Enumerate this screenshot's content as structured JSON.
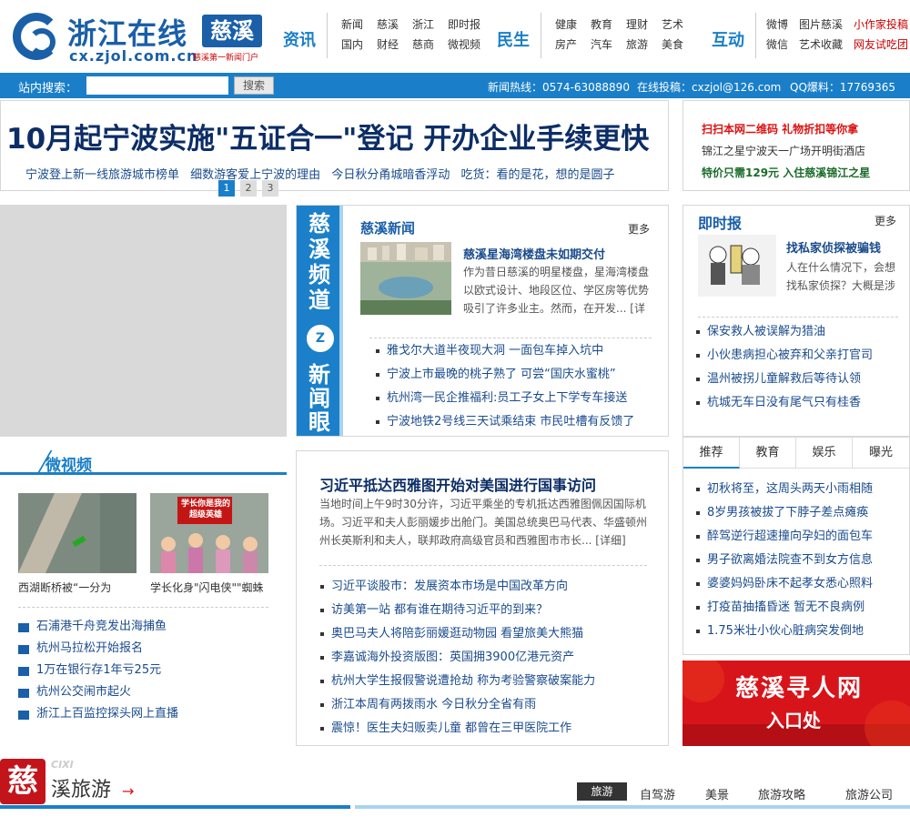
{
  "site": {
    "name": "浙江在线",
    "tag": "慈溪",
    "domain": "cx.zjol.com.cn",
    "slogan": "慈溪第一新闻门户"
  },
  "nav": {
    "groups": [
      {
        "head": "资讯",
        "items": [
          "新闻",
          "慈溪",
          "浙江",
          "即时报",
          "国内",
          "财经",
          "慈商",
          "微视频"
        ]
      },
      {
        "head": "民生",
        "items": [
          "健康",
          "教育",
          "理财",
          "艺术",
          "房产",
          "汽车",
          "旅游",
          "美食"
        ]
      },
      {
        "head": "互动",
        "items": [
          "微博",
          "图片慈溪",
          "小作家投稿",
          "微信",
          "艺术收藏",
          "网友试吃团"
        ]
      }
    ]
  },
  "search": {
    "label": "站内搜索：",
    "button": "搜索",
    "placeholder": "",
    "hotline": "新闻热线：0574-63088890",
    "email": "在线投稿：cxzjol@126.com",
    "qq": "QQ爆料：17769365"
  },
  "headline": {
    "title": "10月起宁波实施\"五证合一\"登记 开办企业手续更快",
    "subs": [
      "宁波登上新一线旅游城市榜单",
      "细数游客爱上宁波的理由",
      "今日秋分甬城暗香浮动",
      "吃货：看的是花，想的是圆子"
    ],
    "pages": [
      "1",
      "2",
      "3"
    ]
  },
  "promo": [
    "扫扫本网二维码 礼物折扣等你拿",
    "锦江之星宁波天一广场开明街酒店",
    "特价只需129元 入住慈溪锦江之星"
  ],
  "channel": {
    "strip_top": [
      "慈",
      "溪",
      "频",
      "道"
    ],
    "strip_bottom": [
      "新",
      "闻",
      "眼"
    ],
    "badge": "Z",
    "title": "慈溪新闻",
    "more": "更多",
    "lead": "慈溪星海湾楼盘未如期交付",
    "summary": "作为昔日慈溪的明星楼盘，星海湾楼盘以欧式设计、地段区位、学区房等优势吸引了许多业主。然而，在开发... [详",
    "list": [
      "雅戈尔大道半夜现大洞 一面包车掉入坑中",
      "宁波上市最晚的桃子熟了 可尝“国庆水蜜桃”",
      "杭州湾一民企推福利:员工子女上下学专车接送",
      "宁波地铁2号线三天试乘结束 市民吐槽有反馈了"
    ]
  },
  "instant": {
    "title": "即时报",
    "more": "更多",
    "lead": "找私家侦探被骗钱",
    "summary": "人在什么情况下，会想找私家侦探？大概是涉",
    "list": [
      "保安救人被误解为猎油",
      "小伙患病担心被弃和父亲打官司",
      "温州被拐儿童解救后等待认领",
      "杭城无车日没有尾气只有桂香"
    ]
  },
  "tabs": {
    "labels": [
      "推荐",
      "教育",
      "娱乐",
      "曝光"
    ],
    "list": [
      "初秋将至，这周头两天小雨相随",
      "8岁男孩被拔了下脖子差点瘫痪",
      "醉驾逆行超速撞向孕妇的面包车",
      "男子欲离婚法院查不到女方信息",
      "婆婆妈妈卧床不起孝女悉心照料",
      "打疫苗抽搐昏迷 暂无不良病例",
      "1.75米壮小伙心脏病突发倒地"
    ]
  },
  "ad": {
    "title": "慈溪寻人网",
    "sub": "入口处"
  },
  "video": {
    "title": "微视频",
    "captions": [
      "西湖断桥被“一分为",
      "学长化身\"闪电侠\"\"蜘蛛"
    ],
    "sign": "学长你是我的超级英雄",
    "list": [
      "石浦港千舟竞发出海捕鱼",
      "杭州马拉松开始报名",
      "1万在银行存1年亏25元",
      "杭州公交闹市起火",
      "浙江上百监控探头网上直播"
    ]
  },
  "main": {
    "lead": "习近平抵达西雅图开始对美国进行国事访问",
    "summary": "当地时间上午9时30分许，习近平乘坐的专机抵达西雅图佩因国际机场。习近平和夫人彭丽媛步出舱门。美国总统奥巴马代表、华盛顿州州长英斯利和夫人，联邦政府高级官员和西雅图市市长... [详细]",
    "list": [
      "习近平谈股市：发展资本市场是中国改革方向",
      "访美第一站 都有谁在期待习近平的到来？",
      "奥巴马夫人将陪彭丽媛逛动物园 看望旅美大熊猫",
      "李嘉诚海外投资版图：英国拥3900亿港元资产",
      "杭州大学生报假警说遭抢劫 称为考验警察破案能力",
      "浙江本周有两拨雨水 今日秋分全省有雨",
      "震惊！医生夫妇贩卖儿童 都曾在三甲医院工作"
    ]
  },
  "travel": {
    "badge": "慈",
    "pinyin": "CIXI",
    "title": "溪旅游",
    "tabs": [
      "旅游",
      "自驾游",
      "美景",
      "旅游攻略",
      "旅游公司"
    ]
  },
  "colors": {
    "brand": "#1a5fa8",
    "accent": "#1a7fc8",
    "red": "#d11"
  }
}
